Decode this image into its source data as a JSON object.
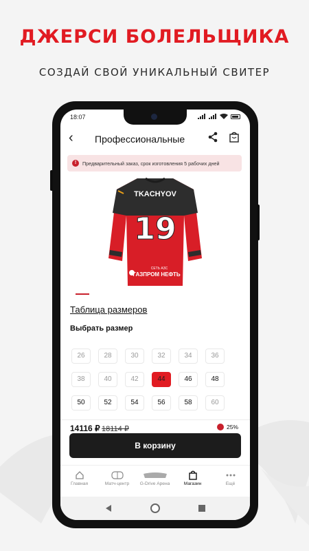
{
  "promo": {
    "title": "ДЖЕРСИ БОЛЕЛЬЩИКА",
    "subtitle": "СОЗДАЙ СВОЙ УНИКАЛЬНЫЙ СВИТЕР"
  },
  "status_bar": {
    "time": "18:07"
  },
  "app_bar": {
    "title": "Профессиональные"
  },
  "notice": {
    "text": "Предварительный заказ, срок изготовления 5 рабочих дней"
  },
  "product": {
    "jersey_name": "TKACHYOV",
    "jersey_number": "19",
    "sponsor_small": "СЕТЬ АЗС",
    "sponsor": "ГАЗПРОМ НЕФТЬ"
  },
  "size_table_link": "Таблица размеров",
  "size_heading": "Выбрать размер",
  "sizes": [
    {
      "label": "26",
      "available": false
    },
    {
      "label": "28",
      "available": false
    },
    {
      "label": "30",
      "available": false
    },
    {
      "label": "32",
      "available": false
    },
    {
      "label": "34",
      "available": false
    },
    {
      "label": "36",
      "available": false
    },
    {
      "label": "38",
      "available": false
    },
    {
      "label": "40",
      "available": false
    },
    {
      "label": "42",
      "available": false
    },
    {
      "label": "44",
      "available": true,
      "selected": true
    },
    {
      "label": "46",
      "available": true
    },
    {
      "label": "48",
      "available": true
    },
    {
      "label": "50",
      "available": true
    },
    {
      "label": "52",
      "available": true
    },
    {
      "label": "54",
      "available": true
    },
    {
      "label": "56",
      "available": true
    },
    {
      "label": "58",
      "available": true
    },
    {
      "label": "60",
      "available": false
    }
  ],
  "pricing": {
    "price": "14116 ₽",
    "old_price": "18114 ₽",
    "discount": "25%"
  },
  "cart_button": "В корзину",
  "bottom_nav": [
    {
      "label": "Главная",
      "icon": "home-icon"
    },
    {
      "label": "Матч-центр",
      "icon": "rink-icon"
    },
    {
      "label": "G-Drive Арена",
      "icon": "arena-icon"
    },
    {
      "label": "Магазин",
      "icon": "shop-bag-icon",
      "active": true
    },
    {
      "label": "Ещё",
      "icon": "more-dots-icon"
    }
  ],
  "colors": {
    "brand_red": "#e11b22",
    "notice_bg": "#f8e3e4",
    "button_dark": "#1c1c1c"
  }
}
